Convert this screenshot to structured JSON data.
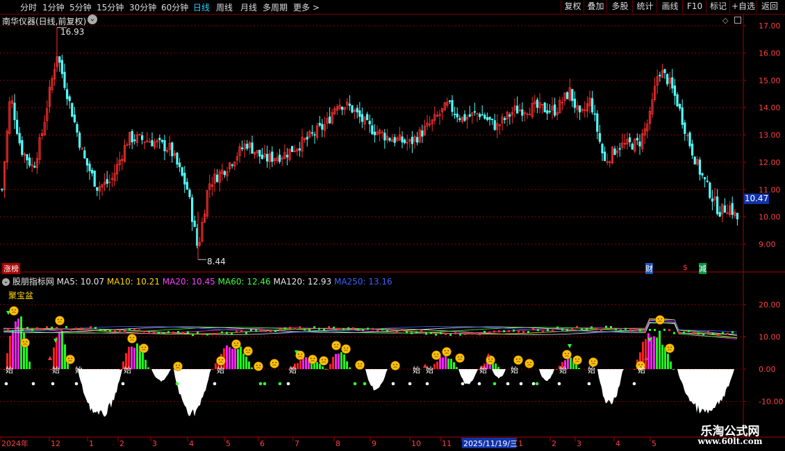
{
  "toolbar": {
    "tabs": [
      {
        "label": "分时",
        "active": false
      },
      {
        "label": "1分钟",
        "active": false
      },
      {
        "label": "5分钟",
        "active": false
      },
      {
        "label": "15分钟",
        "active": false
      },
      {
        "label": "30分钟",
        "active": false
      },
      {
        "label": "60分钟",
        "active": false
      },
      {
        "label": "日线",
        "active": true
      },
      {
        "label": "周线",
        "active": false
      },
      {
        "label": "月线",
        "active": false
      },
      {
        "label": "多周期",
        "active": false
      },
      {
        "label": "更多 >",
        "active": false
      }
    ],
    "buttons": [
      "复权",
      "叠加",
      "多股",
      "统计",
      "画线",
      "F10",
      "标记",
      "+自选",
      "返回"
    ]
  },
  "main": {
    "title": "南华仪器(日线,前复权)",
    "high_label": "16.93",
    "low_label": "8.44",
    "current_price": "10.47",
    "price_ticks": [
      "17.00",
      "16.00",
      "15.00",
      "14.00",
      "13.00",
      "12.00",
      "11.00",
      "10.00",
      "9.00"
    ],
    "zt_label": "涨榜",
    "markers": [
      "财",
      "$",
      "减"
    ]
  },
  "sub": {
    "indicator_name": "股朋指标网",
    "ma": [
      {
        "label": "MA5: 10.07",
        "color": "#e8e8e8"
      },
      {
        "label": "MA10: 10.21",
        "color": "#ffd700"
      },
      {
        "label": "MA20: 10.45",
        "color": "#ff40ff"
      },
      {
        "label": "MA60: 12.46",
        "color": "#40ff40"
      },
      {
        "label": "MA120: 12.93",
        "color": "#e8e8e8"
      },
      {
        "label": "MA250: 13.16",
        "color": "#4060ff"
      }
    ],
    "jbp_label": "聚宝盆",
    "ticks": [
      "20.00",
      "10.00",
      "0.00",
      "-10.00"
    ],
    "start_label": "始"
  },
  "xaxis": {
    "labels": [
      "2024年",
      "12",
      "1",
      "2",
      "3",
      "4",
      "5",
      "6",
      "7",
      "8",
      "9",
      "10",
      "11",
      "2025/11/19/三",
      "1",
      "2",
      "3",
      "4",
      "5"
    ]
  },
  "watermark": {
    "line1": "乐淘公式网",
    "line2": "www.60lt.com"
  },
  "chart_data": {
    "type": "candlestick",
    "price_range": [
      8.44,
      16.93
    ],
    "indicator_range": [
      -13,
      24
    ]
  },
  "colors": {
    "up": "#ff3030",
    "down": "#54ffff",
    "grid": "#8b0000",
    "accent": "#3cf"
  }
}
